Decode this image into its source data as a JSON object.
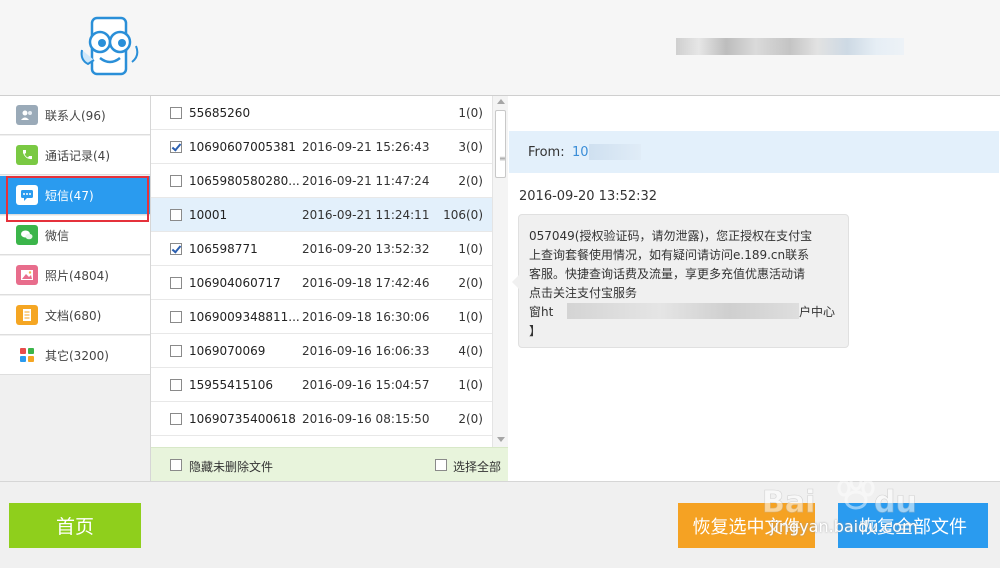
{
  "header": {
    "logo_icon": "phone-face-logo-icon"
  },
  "sidebar": {
    "items": [
      {
        "label": "联系人(96)",
        "icon": "contacts-icon",
        "color": "#9aaab8"
      },
      {
        "label": "通话记录(4)",
        "icon": "phone-call-icon",
        "color": "#7ac943"
      },
      {
        "label": "短信(47)",
        "icon": "sms-icon",
        "color": "#ffffff"
      },
      {
        "label": "微信",
        "icon": "wechat-icon",
        "color": "#3bb54a"
      },
      {
        "label": "照片(4804)",
        "icon": "photo-icon",
        "color": "#e86d8c"
      },
      {
        "label": "文档(680)",
        "icon": "document-icon",
        "color": "#f5a623"
      },
      {
        "label": "其它(3200)",
        "icon": "other-icon",
        "color": "#e84c4c"
      }
    ]
  },
  "messages": [
    {
      "number": "55685260",
      "date": "",
      "count": "1(0)",
      "checked": false
    },
    {
      "number": "10690607005381",
      "date": "2016-09-21 15:26:43",
      "count": "3(0)",
      "checked": true
    },
    {
      "number": "1065980580280...",
      "date": "2016-09-21 11:47:24",
      "count": "2(0)",
      "checked": false
    },
    {
      "number": "10001",
      "date": "2016-09-21 11:24:11",
      "count": "106(0)",
      "checked": false
    },
    {
      "number": "106598771",
      "date": "2016-09-20 13:52:32",
      "count": "1(0)",
      "checked": true
    },
    {
      "number": "106904060717",
      "date": "2016-09-18 17:42:46",
      "count": "2(0)",
      "checked": false
    },
    {
      "number": "1069009348811...",
      "date": "2016-09-18 16:30:06",
      "count": "1(0)",
      "checked": false
    },
    {
      "number": "1069070069",
      "date": "2016-09-16 16:06:33",
      "count": "4(0)",
      "checked": false
    },
    {
      "number": "15955415106",
      "date": "2016-09-16 15:04:57",
      "count": "1(0)",
      "checked": false
    },
    {
      "number": "10690735400618",
      "date": "2016-09-16 08:15:50",
      "count": "2(0)",
      "checked": false
    }
  ],
  "list_footer": {
    "hide_deleted_label": "隐藏未删除文件",
    "select_all_label": "选择全部"
  },
  "detail": {
    "from_label": "From:",
    "from_value": "10",
    "time": "2016-09-20 13:52:32",
    "lines": [
      "057049(授权验证码，请勿泄露)，您正授权在支付宝",
      "上查询套餐使用情况，如有疑问请访问e.189.cn联系",
      "客服。快捷查询话费及流量，享更多充值优惠活动请",
      "点击关注支付宝服务",
      "窗ht",
      "户中心",
      "】"
    ]
  },
  "bottom": {
    "home_label": "首页",
    "recover_selected_label": "恢复选中文件",
    "recover_all_label": "恢复全部文件"
  },
  "watermark": {
    "text": "jingyan.baidu.com"
  },
  "colors": {
    "accent_blue": "#2a9bef",
    "home_green": "#8fcf1c",
    "recover_orange": "#f5a223",
    "highlight_red": "#e5313b"
  }
}
